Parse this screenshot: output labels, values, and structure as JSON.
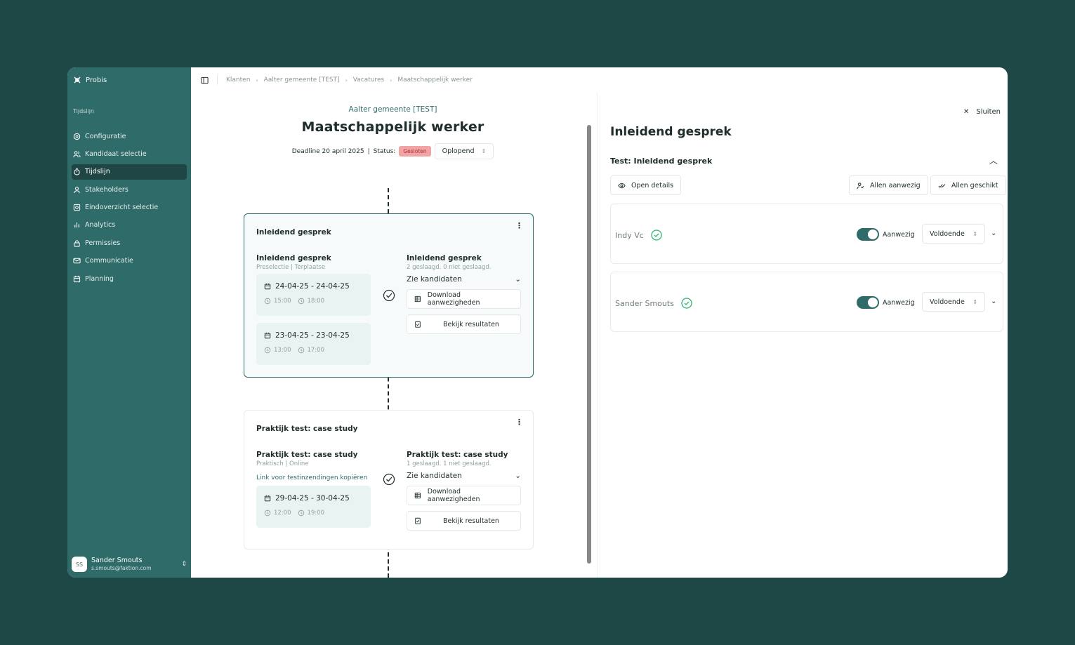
{
  "sidebar": {
    "brand": "Probis",
    "section_label": "Tijdslijn",
    "items": [
      {
        "label": "Configuratie",
        "icon": "gear-icon"
      },
      {
        "label": "Kandidaat selectie",
        "icon": "users-icon"
      },
      {
        "label": "Tijdslijn",
        "icon": "timer-icon",
        "active": true
      },
      {
        "label": "Stakeholders",
        "icon": "user-icon"
      },
      {
        "label": "Eindoverzicht selectie",
        "icon": "overview-icon"
      },
      {
        "label": "Analytics",
        "icon": "bar-chart-icon"
      },
      {
        "label": "Permissies",
        "icon": "lock-icon"
      },
      {
        "label": "Communicatie",
        "icon": "mail-icon"
      },
      {
        "label": "Planning",
        "icon": "calendar-icon"
      }
    ],
    "user": {
      "initials": "SS",
      "name": "Sander Smouts",
      "email": "s.smouts@faktion.com"
    }
  },
  "breadcrumb": [
    "Klanten",
    "Aalter gemeente [TEST]",
    "Vacatures",
    "Maatschappelijk werker"
  ],
  "job": {
    "organization": "Aalter gemeente [TEST]",
    "title": "Maatschappelijk werker",
    "deadline": "Deadline 20 april 2025",
    "status_label": "Status:",
    "status": "Gesloten",
    "order": "Oplopend"
  },
  "cards": [
    {
      "title": "Inleidend gesprek",
      "left_title": "Inleidend gesprek",
      "left_sub": "Preselectie | Terplaatse",
      "link": "",
      "dates": [
        {
          "range": "24-04-25 - 24-04-25",
          "start": "15:00",
          "end": "18:00"
        },
        {
          "range": "23-04-25 - 23-04-25",
          "start": "13:00",
          "end": "17:00"
        }
      ],
      "right_title": "Inleidend gesprek",
      "right_sub": "2 geslaagd. 0 niet geslaagd.",
      "zie": "Zie kandidaten",
      "download": "Download aanwezigheden",
      "results": "Bekijk resultaten"
    },
    {
      "title": "Praktijk test: case study",
      "left_title": "Praktijk test: case study",
      "left_sub": "Praktisch | Online",
      "link": "Link voor testinzendingen kopiëren",
      "dates": [
        {
          "range": "29-04-25 - 30-04-25",
          "start": "12:00",
          "end": "19:00"
        }
      ],
      "right_title": "Praktijk test: case study",
      "right_sub": "1 geslaagd. 1 niet geslaagd.",
      "zie": "Zie kandidaten",
      "download": "Download aanwezigheden",
      "results": "Bekijk resultaten"
    }
  ],
  "panel": {
    "close": "Sluiten",
    "title": "Inleidend gesprek",
    "subtitle": "Test: Inleidend gesprek",
    "open_details": "Open details",
    "all_present": "Allen aanwezig",
    "all_suitable": "Allen geschikt",
    "participants": [
      {
        "name": "Indy Vc",
        "present_label": "Aanwezig",
        "present": true,
        "result": "Voldoende"
      },
      {
        "name": "Sander Smouts",
        "present_label": "Aanwezig",
        "present": true,
        "result": "Voldoende"
      }
    ]
  },
  "colors": {
    "accent": "#2f6b69",
    "background": "#1e4846",
    "badge": "#f2a3a3"
  }
}
